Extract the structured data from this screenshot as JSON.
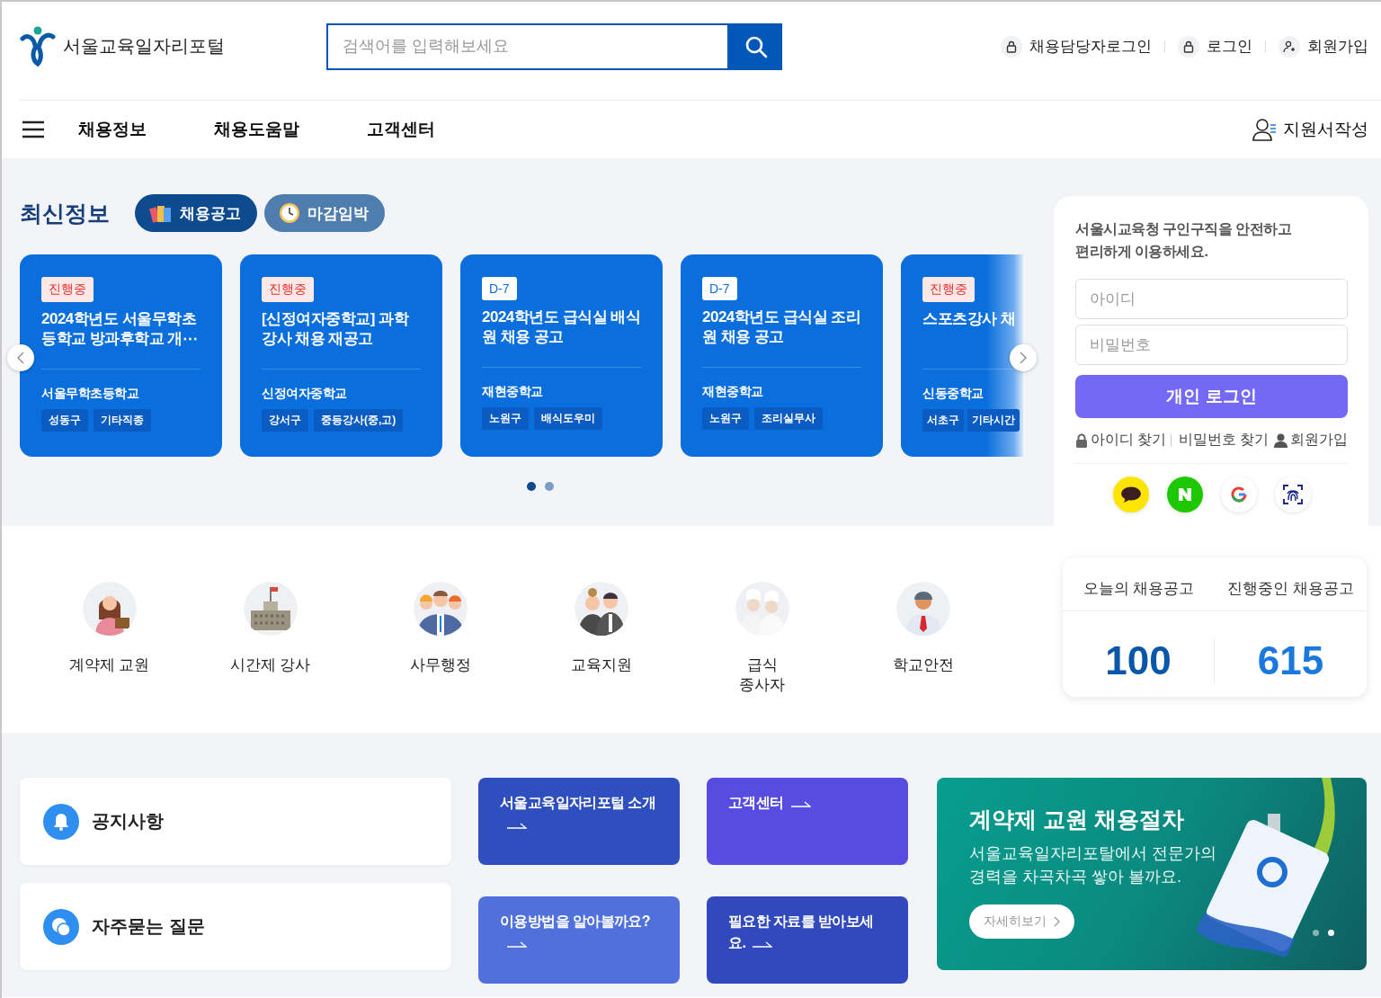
{
  "header": {
    "logo_text": "서울교육일자리포털",
    "search": {
      "placeholder": "검색어를 입력해보세요"
    },
    "util_links": [
      {
        "label": "채용담당자로그인",
        "kind": "lock"
      },
      {
        "label": "로그인",
        "kind": "lock"
      },
      {
        "label": "회원가입",
        "kind": "user"
      }
    ]
  },
  "nav": {
    "items": [
      "채용정보",
      "채용도움말",
      "고객센터"
    ],
    "apply_link": "지원서작성"
  },
  "latest": {
    "title": "최신정보",
    "tabs": [
      {
        "label": "채용공고",
        "kind": "books",
        "selected": true
      },
      {
        "label": "마감임박",
        "kind": "clock",
        "selected": false
      }
    ],
    "cards": [
      {
        "status": "진행중",
        "kind": "ongoing",
        "title": "2024학년도 서울무학초등학교 방과후학교 개⋯",
        "school": "서울무학초등학교",
        "tags": [
          "성동구",
          "기타직종"
        ]
      },
      {
        "status": "진행중",
        "kind": "ongoing",
        "title": "[신정여자중학교] 과학 강사 채용 재공고",
        "school": "신정여자중학교",
        "tags": [
          "강서구",
          "중등강사(중,고)"
        ]
      },
      {
        "status": "D-7",
        "kind": "dday",
        "title": "2024학년도 급식실 배식원 채용 공고",
        "school": "재현중학교",
        "tags": [
          "노원구",
          "배식도우미"
        ]
      },
      {
        "status": "D-7",
        "kind": "dday",
        "title": "2024학년도 급식실 조리원 채용 공고",
        "school": "재현중학교",
        "tags": [
          "노원구",
          "조리실무사"
        ]
      },
      {
        "status": "진행중",
        "kind": "ongoing",
        "title": "스포츠강사 채",
        "school": "신동중학교",
        "tags": [
          "서초구",
          "기타시간"
        ]
      }
    ],
    "pager": [
      {
        "selected": true
      },
      {
        "selected": false
      }
    ]
  },
  "login": {
    "message": "서울시교육청 구인구직을 안전하고 편리하게 이용하세요.",
    "id_placeholder": "아이디",
    "pw_placeholder": "비밀번호",
    "button": "개인 로그인",
    "links": [
      {
        "label": "아이디 찾기",
        "kind": "lock"
      },
      {
        "label": "비밀번호 찾기",
        "kind": "none"
      },
      {
        "label": "회원가입",
        "kind": "user"
      }
    ],
    "social": [
      {
        "kind": "talk"
      },
      {
        "kind": "naver"
      },
      {
        "kind": "google"
      },
      {
        "kind": "fingerprint"
      }
    ]
  },
  "categories": [
    {
      "label": "계약제 교원",
      "kind": "teacher"
    },
    {
      "label": "시간제 강사",
      "kind": "building"
    },
    {
      "label": "사무행정",
      "kind": "office"
    },
    {
      "label": "교육지원",
      "kind": "support"
    },
    {
      "label": "급식\n종사자",
      "kind": "cook"
    },
    {
      "label": "학교안전",
      "kind": "guard"
    }
  ],
  "stats": [
    {
      "label": "오늘의 채용공고",
      "value": "100"
    },
    {
      "label": "진행중인 채용공고",
      "value": "615"
    }
  ],
  "quick": {
    "notices": [
      {
        "label": "공지사항",
        "kind": "bell"
      },
      {
        "label": "자주묻는 질문",
        "kind": "chat"
      }
    ],
    "tiles": [
      {
        "label": "서울교육일자리포털 소개",
        "color": "#2f4fbf"
      },
      {
        "label": "고객센터",
        "color": "#564ce0"
      },
      {
        "label": "이용방법을 알아볼까요?",
        "color": "#5070dc"
      },
      {
        "label": "필요한 자료를 받아보세요.",
        "color": "#3149bd"
      }
    ]
  },
  "banner": {
    "title": "계약제 교원 채용절차",
    "text": "서울교육일자리포탈에서 전문가의 경력을 차곡차곡 쌓아 볼까요.",
    "button": "자세히보기",
    "pager": [
      {
        "selected": false
      },
      {
        "selected": true
      }
    ]
  }
}
